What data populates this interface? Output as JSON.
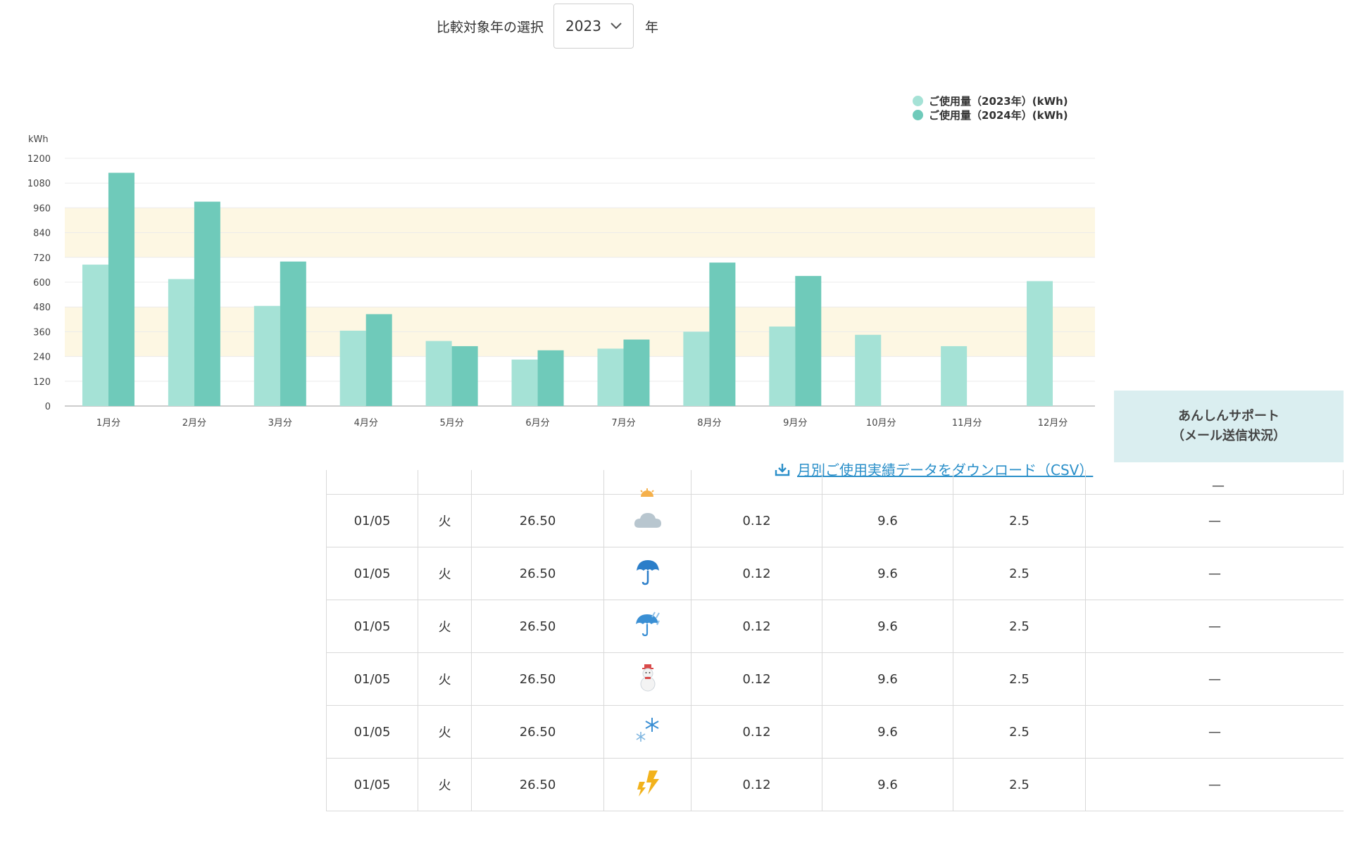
{
  "year_selector": {
    "label": "比較対象年の選択",
    "selected": "2023",
    "suffix": "年"
  },
  "legend": [
    {
      "label": "ご使用量（2023年）(kWh)",
      "color": "#a5e2d6"
    },
    {
      "label": "ご使用量（2024年）(kWh)",
      "color": "#6fcaba"
    }
  ],
  "chart_data": {
    "type": "bar",
    "ylabel": "kWh",
    "ylim": [
      0,
      1200
    ],
    "yticks": [
      0,
      120,
      240,
      360,
      480,
      600,
      720,
      840,
      960,
      1080,
      1200
    ],
    "bands": [
      [
        240,
        480
      ],
      [
        720,
        960
      ]
    ],
    "categories": [
      "1月分",
      "2月分",
      "3月分",
      "4月分",
      "5月分",
      "6月分",
      "7月分",
      "8月分",
      "9月分",
      "10月分",
      "11月分",
      "12月分"
    ],
    "series": [
      {
        "name": "ご使用量（2023年）(kWh)",
        "values": [
          685,
          615,
          485,
          365,
          315,
          225,
          278,
          360,
          385,
          345,
          290,
          605
        ]
      },
      {
        "name": "ご使用量（2024年）(kWh)",
        "values": [
          1130,
          990,
          700,
          445,
          290,
          270,
          322,
          695,
          630,
          null,
          null,
          null
        ]
      }
    ]
  },
  "download_link": "月別ご使用実績データをダウンロード（CSV）",
  "side_header": {
    "line1": "あんしんサポート",
    "line2": "（メール送信状況）"
  },
  "partial_row_dash": "—",
  "rows": [
    {
      "date": "01/05",
      "weekday": "火",
      "temp": "26.50",
      "weather_icon": "cloud-icon",
      "c1": "0.12",
      "c2": "9.6",
      "c3": "2.5",
      "status": "—"
    },
    {
      "date": "01/05",
      "weekday": "火",
      "temp": "26.50",
      "weather_icon": "umbrella-icon",
      "c1": "0.12",
      "c2": "9.6",
      "c3": "2.5",
      "status": "—"
    },
    {
      "date": "01/05",
      "weekday": "火",
      "temp": "26.50",
      "weather_icon": "heavy-rain-icon",
      "c1": "0.12",
      "c2": "9.6",
      "c3": "2.5",
      "status": "—"
    },
    {
      "date": "01/05",
      "weekday": "火",
      "temp": "26.50",
      "weather_icon": "snowman-icon",
      "c1": "0.12",
      "c2": "9.6",
      "c3": "2.5",
      "status": "—"
    },
    {
      "date": "01/05",
      "weekday": "火",
      "temp": "26.50",
      "weather_icon": "snowflake-icon",
      "c1": "0.12",
      "c2": "9.6",
      "c3": "2.5",
      "status": "—"
    },
    {
      "date": "01/05",
      "weekday": "火",
      "temp": "26.50",
      "weather_icon": "thunder-icon",
      "c1": "0.12",
      "c2": "9.6",
      "c3": "2.5",
      "status": "—"
    }
  ]
}
